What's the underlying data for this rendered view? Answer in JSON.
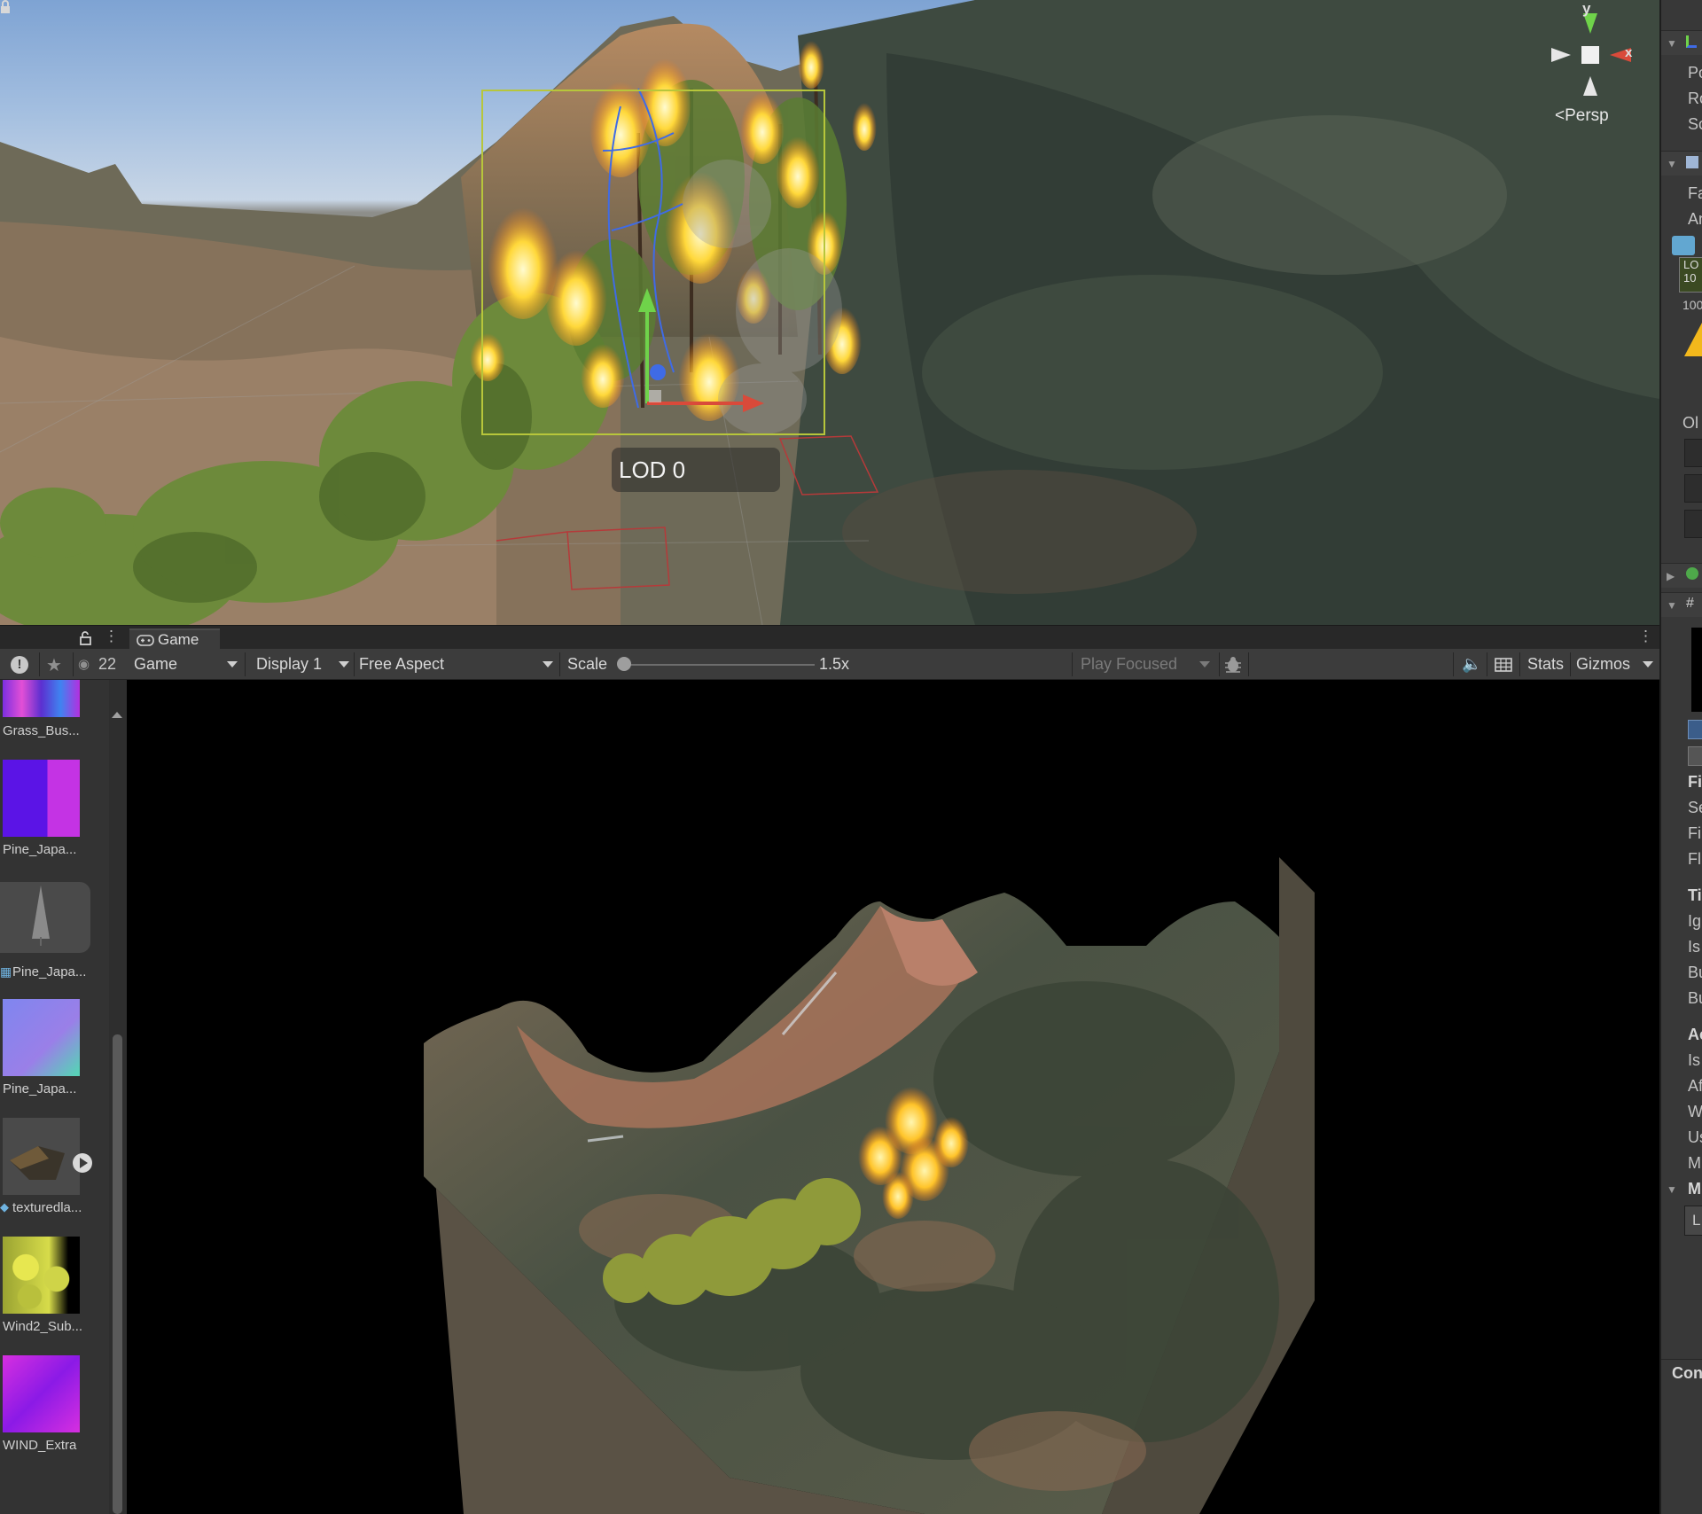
{
  "scene": {
    "lod_label": "LOD 0",
    "camera_mode": "Persp",
    "axis_y": "y",
    "axis_x": "x"
  },
  "bottom_tabs": {
    "game_tab": "Game"
  },
  "project_toolbar": {
    "hidden_count": "22"
  },
  "game_toolbar": {
    "view_select": "Game",
    "display_select": "Display 1",
    "aspect_select": "Free Aspect",
    "scale_label": "Scale",
    "scale_value": "1.5x",
    "play_mode_select": "Play Focused",
    "stats_button": "Stats",
    "gizmos_button": "Gizmos"
  },
  "project_assets": [
    {
      "label": "Grass_Bus...",
      "kind": "texture"
    },
    {
      "label": "Pine_Japa...",
      "kind": "texture"
    },
    {
      "label": "Pine_Japa...",
      "kind": "prefab"
    },
    {
      "label": "Pine_Japa...",
      "kind": "texture"
    },
    {
      "label": "texturedla...",
      "kind": "model"
    },
    {
      "label": "Wind2_Sub...",
      "kind": "texture"
    },
    {
      "label": "WIND_Extra",
      "kind": "texture"
    }
  ],
  "inspector_fragments": {
    "r1": "Po",
    "r2": "Ro",
    "r3": "Sc",
    "r4": "Fa",
    "r5": "An",
    "r6": "LO",
    "r7": "10",
    "r8": "100",
    "r9": "Ol",
    "r10": "Fi",
    "r11": "Se",
    "r12": "Fi",
    "r13": "Fl",
    "r14": "Ti",
    "r15": "Ig",
    "r16": "Is",
    "r17": "Bu",
    "r18": "Bu",
    "r19": "Ac",
    "r20": "Is",
    "r21": "Af",
    "r22": "W",
    "r23": "Us",
    "r24": "M",
    "r25": "M",
    "r26": "L",
    "r27": "Con"
  },
  "colors": {
    "editor_bg": "#383838",
    "toolbar_bg": "#3c3c3c",
    "fire": "#ffd23a",
    "selection_box": "#b7c63b",
    "gizmo_x": "#d94a3a",
    "gizmo_y": "#6fd34a",
    "gizmo_z": "#3f6be6"
  }
}
